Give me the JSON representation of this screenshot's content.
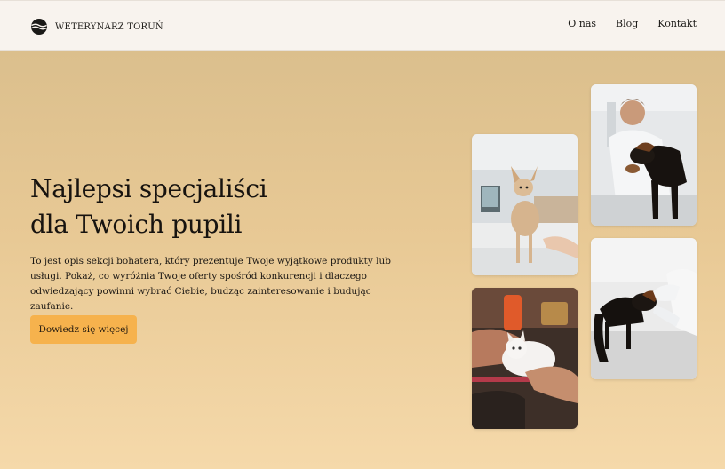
{
  "header": {
    "brand_name": "WETERYNARZ TORUŃ",
    "logo_icon": "waves-logo-icon",
    "nav": [
      {
        "label": "O nas"
      },
      {
        "label": "Blog"
      },
      {
        "label": "Kontakt"
      }
    ]
  },
  "hero": {
    "title_line1": "Najlepsi specjaliści",
    "title_line2": "dla Twoich pupili",
    "description": "To jest opis sekcji bohatera, który prezentuje Twoje wyjątkowe produkty lub usługi. Pokaż, co wyróżnia Twoje oferty spośród konkurencji i dlaczego odwiedzający powinni wybrać Ciebie, budząc zainteresowanie i budując zaufanie.",
    "cta_label": "Dowiedz się więcej"
  },
  "gallery": [
    {
      "subject": "chihuahua-on-exam-table-photo"
    },
    {
      "subject": "vet-holding-dachshund-photo"
    },
    {
      "subject": "white-kitten-in-hands-photo"
    },
    {
      "subject": "dachshund-exam-gloved-hands-photo"
    }
  ],
  "colors": {
    "header_bg": "#f8f3ee",
    "hero_top": "#dbbf8d",
    "hero_bottom": "#f5d9aa",
    "cta_bg": "#f6b24d",
    "text": "#17130f"
  }
}
